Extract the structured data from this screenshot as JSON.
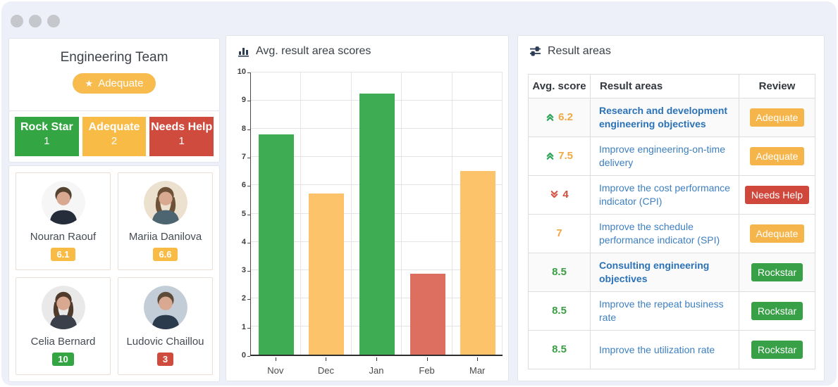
{
  "window": {
    "chrome_dots": 3
  },
  "team_panel": {
    "title": "Engineering Team",
    "badge": {
      "label": "Adequate",
      "icon": "star-icon",
      "color": "#f8bb4d"
    }
  },
  "stats": [
    {
      "label": "Rock Star",
      "value": "1",
      "color": "#34a543"
    },
    {
      "label": "Adequate",
      "value": "2",
      "color": "#f8bb45"
    },
    {
      "label": "Needs Help",
      "value": "1",
      "color": "#ce4b3e"
    }
  ],
  "members": [
    {
      "name": "Nouran Raouf",
      "score": "6.1",
      "score_color": "#f8bb45",
      "avatar": {
        "bg": "#f6f6f6",
        "hair": "#53422f",
        "top": "#252c3a",
        "long_hair": false
      }
    },
    {
      "name": "Mariia Danilova",
      "score": "6.6",
      "score_color": "#f8bb45",
      "avatar": {
        "bg": "#ece0cf",
        "hair": "#6d5138",
        "top": "#4d6570",
        "long_hair": true
      }
    },
    {
      "name": "Celia Bernard",
      "score": "10",
      "score_color": "#34a543",
      "avatar": {
        "bg": "#e9e9e9",
        "hair": "#4f3a2b",
        "top": "#3a3f4a",
        "long_hair": true
      }
    },
    {
      "name": "Ludovic Chaillou",
      "score": "3",
      "score_color": "#ce4b3e",
      "avatar": {
        "bg": "#c3cdd7",
        "hair": "#5d4a38",
        "top": "#2c3a4e",
        "long_hair": false
      }
    }
  ],
  "chart_panel": {
    "title": "Avg. result area scores",
    "icon": "bar-chart-icon",
    "chart_data": {
      "type": "bar",
      "title": "Avg. result area scores",
      "categories": [
        "Nov",
        "Dec",
        "Jan",
        "Feb",
        "Mar"
      ],
      "values": [
        7.8,
        5.7,
        9.25,
        2.87,
        6.5
      ],
      "bar_colors": [
        "#3eac52",
        "#fcc36a",
        "#3eac52",
        "#dc6f60",
        "#fcc36a"
      ],
      "xlabel": "",
      "ylabel": "",
      "ylim": [
        0,
        10
      ],
      "ytick_step": 1,
      "grid": true,
      "legend": "none"
    }
  },
  "results_panel": {
    "title": "Result areas",
    "icon": "sliders-icon",
    "table": {
      "headers": [
        "Avg. score",
        "Result areas",
        "Review"
      ],
      "trend_colors": {
        "up": "#2fa45b",
        "down": "#d4574a"
      },
      "rows": [
        {
          "score": "6.2",
          "score_color": "#f0a843",
          "trend": "up",
          "area": "Research and development engineering objectives",
          "bold": true,
          "shaded": true,
          "review": "Adequate",
          "review_color": "#f5b54b"
        },
        {
          "score": "7.5",
          "score_color": "#f0a843",
          "trend": "up",
          "area": "Improve engineering-on-time delivery",
          "bold": false,
          "shaded": false,
          "review": "Adequate",
          "review_color": "#f5b54b"
        },
        {
          "score": "4",
          "score_color": "#d14b3b",
          "trend": "down",
          "area": "Improve the cost performance indicator (CPI)",
          "bold": false,
          "shaded": false,
          "review": "Needs Help",
          "review_color": "#d0473c"
        },
        {
          "score": "7",
          "score_color": "#f0a843",
          "trend": "none",
          "area": "Improve the schedule performance indicator (SPI)",
          "bold": false,
          "shaded": false,
          "review": "Adequate",
          "review_color": "#f5b54b"
        },
        {
          "score": "8.5",
          "score_color": "#3a9e44",
          "trend": "none",
          "area": "Consulting engineering objectives",
          "bold": true,
          "shaded": true,
          "review": "Rockstar",
          "review_color": "#38a047"
        },
        {
          "score": "8.5",
          "score_color": "#3a9e44",
          "trend": "none",
          "area": "Improve the repeat business rate",
          "bold": false,
          "shaded": false,
          "review": "Rockstar",
          "review_color": "#38a047"
        },
        {
          "score": "8.5",
          "score_color": "#3a9e44",
          "trend": "none",
          "area": "Improve the utilization rate",
          "bold": false,
          "shaded": false,
          "review": "Rockstar",
          "review_color": "#38a047"
        }
      ]
    }
  }
}
